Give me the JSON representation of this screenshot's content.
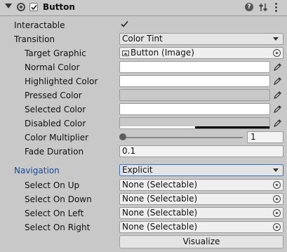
{
  "header": {
    "title": "Button",
    "enabled": true,
    "icons": [
      "foldout-arrow-icon",
      "component-icon",
      "enable-checkbox",
      "help-icon",
      "preset-icon",
      "context-menu-icon"
    ]
  },
  "properties": {
    "interactable": {
      "label": "Interactable",
      "checked": true
    },
    "transition": {
      "label": "Transition",
      "value": "Color Tint"
    },
    "target_graphic": {
      "label": "Target Graphic",
      "value": "Button (Image)"
    },
    "normal_color": {
      "label": "Normal Color",
      "color": "#ffffff"
    },
    "highlighted_color": {
      "label": "Highlighted Color",
      "color": "#ffffff"
    },
    "pressed_color": {
      "label": "Pressed Color",
      "color": "#c8c8c8"
    },
    "selected_color": {
      "label": "Selected Color",
      "color": "#ffffff"
    },
    "disabled_color": {
      "label": "Disabled Color",
      "color": "#c8c8c8"
    },
    "color_multiplier": {
      "label": "Color Multiplier",
      "value": "1",
      "slider_fraction": 0.0
    },
    "fade_duration": {
      "label": "Fade Duration",
      "value": "0.1"
    }
  },
  "navigation": {
    "label": "Navigation",
    "value": "Explicit",
    "select_on_up": {
      "label": "Select On Up",
      "value": "None (Selectable)"
    },
    "select_on_down": {
      "label": "Select On Down",
      "value": "None (Selectable)"
    },
    "select_on_left": {
      "label": "Select On Left",
      "value": "None (Selectable)"
    },
    "select_on_right": {
      "label": "Select On Right",
      "value": "None (Selectable)"
    },
    "visualize_label": "Visualize"
  },
  "colors": {
    "panel_bg": "#c8c8c8",
    "accent_blue": "#184a94",
    "focus_border": "#3a72c4"
  }
}
